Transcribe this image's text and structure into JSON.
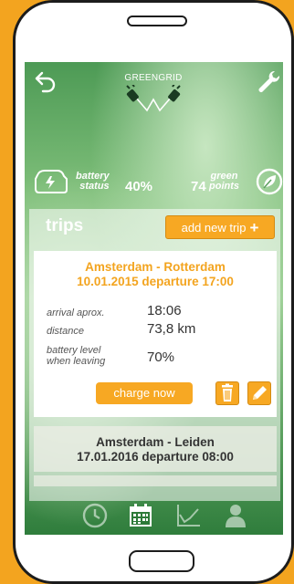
{
  "app": {
    "brand": "GREENGRID"
  },
  "status": {
    "battery_label_line1": "battery",
    "battery_label_line2": "status",
    "battery_value": "40%",
    "points_value": "74",
    "points_label_line1": "green",
    "points_label_line2": "points"
  },
  "trips": {
    "title": "trips",
    "add_label": "add new trip",
    "add_icon": "plus-icon",
    "active": {
      "route_line1": "Amsterdam -  Rotterdam",
      "route_line2": "10.01.2015 departure 17:00",
      "arrival_label": "arrival aprox.",
      "arrival_value": "18:06",
      "distance_label": "distance",
      "distance_value": "73,8 km",
      "battery_label_line1": "battery level",
      "battery_label_line2": "when leaving",
      "battery_value": "70%",
      "charge_label": "charge  now"
    },
    "next": {
      "route_line1": "Amsterdam - Leiden",
      "route_line2": "17.01.2016 departure 08:00"
    }
  },
  "nav": {
    "items": [
      "clock-icon",
      "calendar-icon",
      "chart-icon",
      "user-icon"
    ],
    "active": "calendar-icon"
  },
  "colors": {
    "accent": "#f7a823",
    "frame": "#f3a41f",
    "screen_green": "#4d9a55"
  }
}
